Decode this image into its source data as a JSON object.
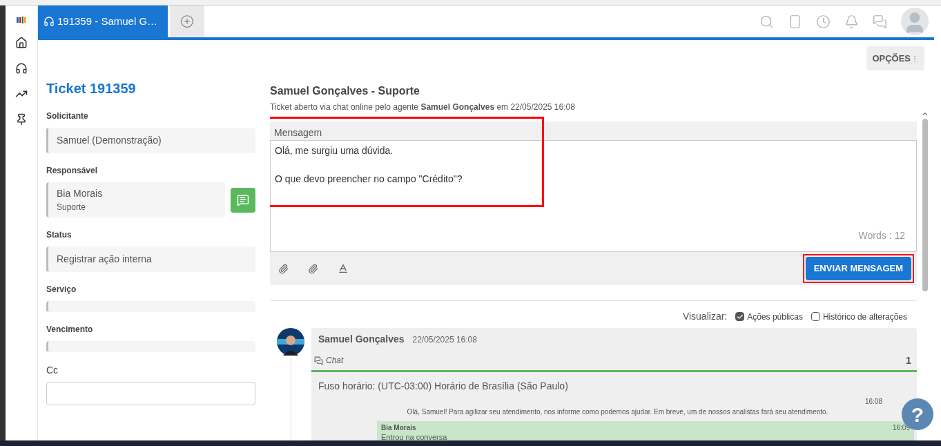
{
  "tabs": [
    {
      "label": "191359 - Samuel G…",
      "selected": true
    }
  ],
  "options_button": "OPÇÕES",
  "ticket": {
    "title": "Ticket 191359",
    "fields": [
      {
        "kind": "value",
        "label": "Solicitante",
        "value": "Samuel (Demonstração)"
      },
      {
        "kind": "person",
        "label": "Responsável",
        "value": "Bia Morais",
        "sub": "Suporte"
      },
      {
        "kind": "value",
        "label": "Status",
        "value": "Registrar ação interna"
      },
      {
        "kind": "empty",
        "label": "Serviço"
      },
      {
        "kind": "empty",
        "label": "Vencimento"
      },
      {
        "kind": "input",
        "label": "Cc"
      }
    ]
  },
  "conversation": {
    "title": "Samuel Gonçalves - Suporte",
    "subtitle": "Ticket aberto via chat online pelo agente **Samuel Gonçalves** em 22/05/2025 16:08",
    "editor": {
      "label": "Mensagem",
      "lines": [
        "Olá, me surgiu uma dúvida.",
        "O que devo preencher no campo \"Crédito\"?"
      ],
      "word_count": "Words : 12",
      "highlighted": true
    },
    "send_button": {
      "label": "ENVIAR MENSAGEM",
      "highlighted": true
    },
    "view_label": "Visualizar:",
    "filters": [
      {
        "label": "Ações públicas",
        "checked": true
      },
      {
        "label": "Histórico de alterações",
        "checked": false
      }
    ],
    "entry": {
      "author": "Samuel Gonçalves",
      "time": "22/05/2025 16:08",
      "channel": "Chat",
      "number": "1",
      "timezone": "Fuso horário: (UTC-03:00) Horário de Brasília (São Paulo)",
      "messages": [
        {
          "kind": "system",
          "time": "16:08",
          "text": "Olá, Samuel! Para agilizar seu atendimento, nos informe como podemos ajudar. Em breve, um de nossos analistas fará seu atendimento."
        },
        {
          "kind": "agent",
          "author": "Bia Morais",
          "time": "16:09",
          "text": "Entrou na conversa"
        }
      ]
    }
  },
  "help_button": "?"
}
